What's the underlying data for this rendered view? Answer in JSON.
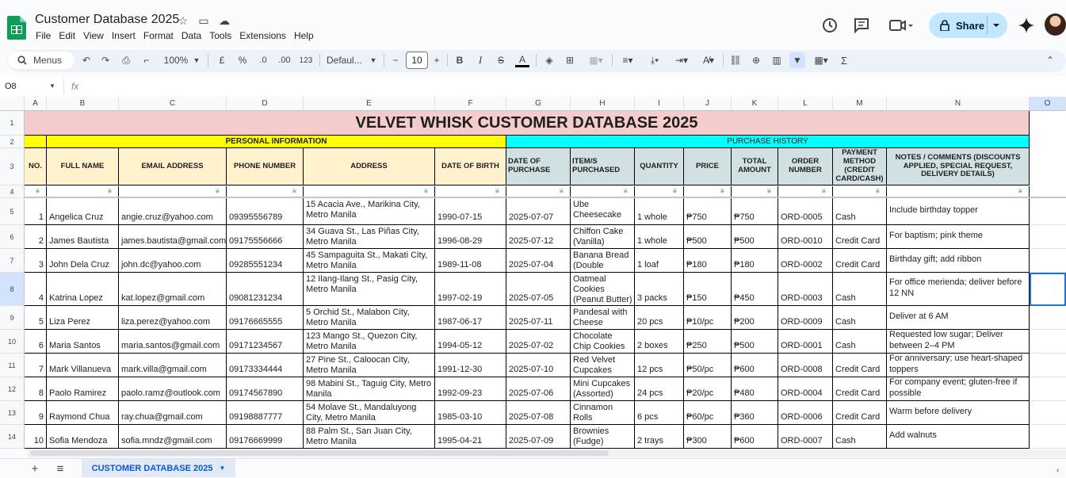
{
  "app": {
    "doc_title": "Customer Database 2025",
    "menu": [
      "File",
      "Edit",
      "View",
      "Insert",
      "Format",
      "Data",
      "Tools",
      "Extensions",
      "Help"
    ],
    "share_label": "Share",
    "accent": "#c2e7ff"
  },
  "toolbar": {
    "search_label": "Menus",
    "zoom": "100%",
    "currency": "£",
    "percent": "%",
    "dec_decrease": ".0",
    "dec_increase": ".00",
    "number_format": "123",
    "font": "Defaul...",
    "font_size": "10",
    "minus": "−",
    "plus": "+",
    "bold": "B",
    "italic": "I",
    "strike": "S",
    "text_color": "A",
    "sigma": "Σ"
  },
  "formula_bar": {
    "cell_ref": "O8",
    "fx": "fx",
    "value": ""
  },
  "columns": [
    "A",
    "B",
    "C",
    "D",
    "E",
    "F",
    "G",
    "H",
    "I",
    "J",
    "K",
    "L",
    "M",
    "N",
    "O"
  ],
  "rows": [
    "1",
    "2",
    "3",
    "4",
    "5",
    "6",
    "7",
    "8",
    "9",
    "10",
    "11",
    "12",
    "13",
    "14"
  ],
  "sheet": {
    "title": "VELVET WHISK CUSTOMER DATABASE 2025",
    "section_personal": "PERSONAL INFORMATION",
    "section_purchase": "PURCHASE HISTORY",
    "headers": [
      "NO.",
      "FULL NAME",
      "EMAIL ADDRESS",
      "PHONE NUMBER",
      "ADDRESS",
      "DATE OF BIRTH",
      "DATE OF PURCHASE",
      "ITEM/S PURCHASED",
      "QUANTITY",
      "PRICE",
      "TOTAL AMOUNT",
      "ORDER NUMBER",
      "PAYMENT METHOD (CREDIT CARD/CASH)",
      "NOTES / COMMENTS (DISCOUNTS APPLIED, SPECIAL REQUEST, DELIVERY DETAILS)"
    ],
    "records": [
      [
        "1",
        "Angelica Cruz",
        "angie.cruz@yahoo.com",
        "09395556789",
        "15 Acacia Ave., Marikina City, Metro Manila",
        "1990-07-15",
        "2025-07-07",
        "Ube Cheesecake",
        "1 whole",
        "₱750",
        "₱750",
        "ORD-0005",
        "Cash",
        "Include birthday topper"
      ],
      [
        "2",
        "James Bautista",
        "james.bautista@gmail.com",
        "09175556666",
        "34 Guava St., Las Piñas City, Metro Manila",
        "1996-08-29",
        "2025-07-12",
        "Chiffon Cake (Vanilla)",
        "1 whole",
        "₱500",
        "₱500",
        "ORD-0010",
        "Credit Card",
        "For baptism; pink theme"
      ],
      [
        "3",
        "John Dela Cruz",
        "john.dc@yahoo.com",
        "09285551234",
        "45 Sampaguita St., Makati City, Metro Manila",
        "1989-11-08",
        "2025-07-04",
        "Banana Bread (Double Choco)",
        "1 loaf",
        "₱180",
        "₱180",
        "ORD-0002",
        "Credit Card",
        "Birthday gift; add ribbon"
      ],
      [
        "4",
        "Katrina Lopez",
        "kat.lopez@gmail.com",
        "09081231234",
        "12 Ilang-Ilang St., Pasig City, Metro Manila",
        "1997-02-19",
        "2025-07-05",
        "Oatmeal Cookies (Peanut Butter)",
        "3 packs",
        "₱150",
        "₱450",
        "ORD-0003",
        "Cash",
        "For office merienda; deliver before 12 NN"
      ],
      [
        "5",
        "Liza Perez",
        "liza.perez@yahoo.com",
        "09176665555",
        "5 Orchid St., Malabon City, Metro Manila",
        "1987-06-17",
        "2025-07-11",
        "Pandesal with Cheese",
        "20 pcs",
        "₱10/pc",
        "₱200",
        "ORD-0009",
        "Cash",
        "Deliver at 6 AM"
      ],
      [
        "6",
        "Maria Santos",
        "maria.santos@gmail.com",
        "09171234567",
        "123 Mango St., Quezon City, Metro Manila",
        "1994-05-12",
        "2025-07-02",
        "Chocolate Chip Cookies",
        "2 boxes",
        "₱250",
        "₱500",
        "ORD-0001",
        "Cash",
        "Requested low sugar; Deliver between 2–4 PM"
      ],
      [
        "7",
        "Mark Villanueva",
        "mark.villa@gmail.com",
        "09173334444",
        "27 Pine St., Caloocan City, Metro Manila",
        "1991-12-30",
        "2025-07-10",
        "Red Velvet Cupcakes",
        "12 pcs",
        "₱50/pc",
        "₱600",
        "ORD-0008",
        "Credit Card",
        "For anniversary; use heart-shaped toppers"
      ],
      [
        "8",
        "Paolo Ramirez",
        "paolo.ramz@outlook.com",
        "09174567890",
        "98 Mabini St., Taguig City, Metro Manila",
        "1992-09-23",
        "2025-07-06",
        "Mini Cupcakes (Assorted)",
        "24 pcs",
        "₱20/pc",
        "₱480",
        "ORD-0004",
        "Credit Card",
        "For company event; gluten-free if possible"
      ],
      [
        "9",
        "Raymond Chua",
        "ray.chua@gmail.com",
        "09198887777",
        "54 Molave St., Mandaluyong City, Metro Manila",
        "1985-03-10",
        "2025-07-08",
        "Cinnamon Rolls",
        "6 pcs",
        "₱60/pc",
        "₱360",
        "ORD-0006",
        "Credit Card",
        "Warm before delivery"
      ],
      [
        "10",
        "Sofia Mendoza",
        "sofia.mndz@gmail.com",
        "09176669999",
        "88 Palm St., San Juan City, Metro Manila",
        "1995-04-21",
        "2025-07-09",
        "Brownies (Fudge)",
        "2 trays",
        "₱300",
        "₱600",
        "ORD-0007",
        "Cash",
        "Add walnuts"
      ]
    ]
  },
  "colors": {
    "title_bg": "#f4cccc",
    "personal_bg": "#ffff00",
    "purchase_bg": "#00ffff",
    "personal_header_bg": "#fff2cc",
    "purchase_header_bg": "#d0e0e3"
  },
  "bottom": {
    "sheet_tab": "CUSTOMER DATABASE 2025",
    "add": "+",
    "list": "≡"
  }
}
